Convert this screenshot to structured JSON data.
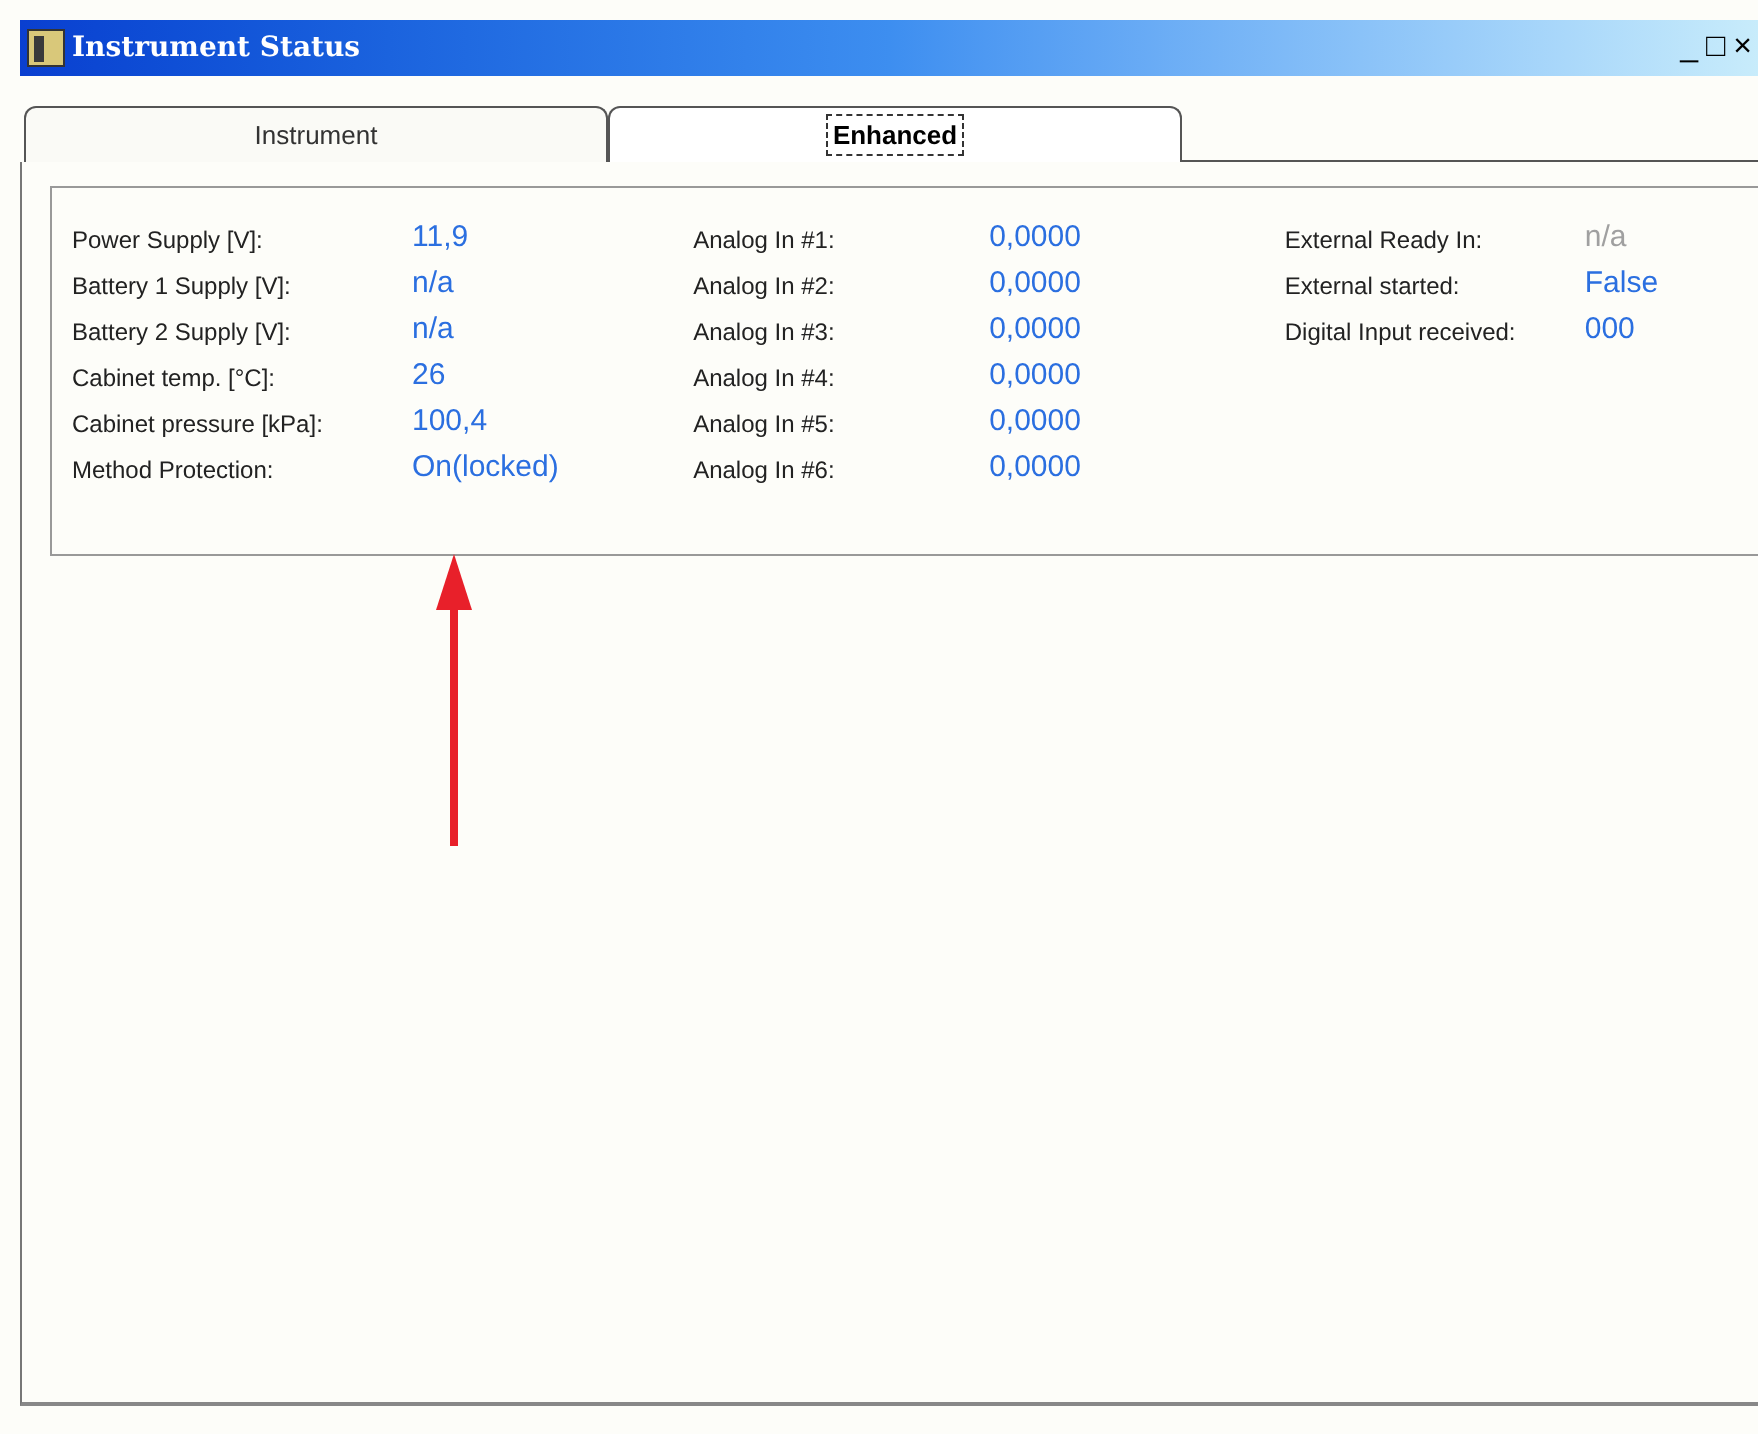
{
  "window": {
    "title": "Instrument Status",
    "controls": [
      "_",
      "□",
      "×"
    ]
  },
  "tabs": [
    {
      "label": "Instrument",
      "selected": false
    },
    {
      "label": "Enhanced",
      "selected": true
    }
  ],
  "columns": [
    {
      "rows": [
        {
          "label": "Power Supply [V]:",
          "value": "11,9",
          "dimmed": false
        },
        {
          "label": "Battery 1 Supply [V]:",
          "value": "n/a",
          "dimmed": false
        },
        {
          "label": "Battery 2 Supply [V]:",
          "value": "n/a",
          "dimmed": false
        },
        {
          "label": "Cabinet temp. [°C]:",
          "value": "26",
          "dimmed": false
        },
        {
          "label": "Cabinet pressure [kPa]:",
          "value": "100,4",
          "dimmed": false
        },
        {
          "label": "Method Protection:",
          "value": "On(locked)",
          "dimmed": false
        }
      ]
    },
    {
      "rows": [
        {
          "label": "Analog In #1:",
          "value": "0,0000",
          "dimmed": false
        },
        {
          "label": "Analog In #2:",
          "value": "0,0000",
          "dimmed": false
        },
        {
          "label": "Analog In #3:",
          "value": "0,0000",
          "dimmed": false
        },
        {
          "label": "Analog In #4:",
          "value": "0,0000",
          "dimmed": false
        },
        {
          "label": "Analog In #5:",
          "value": "0,0000",
          "dimmed": false
        },
        {
          "label": "Analog In #6:",
          "value": "0,0000",
          "dimmed": false
        }
      ]
    },
    {
      "rows": [
        {
          "label": "External Ready In:",
          "value": "n/a",
          "dimmed": true
        },
        {
          "label": "External started:",
          "value": "False",
          "dimmed": false
        },
        {
          "label": "Digital Input received:",
          "value": "000",
          "dimmed": false
        }
      ]
    }
  ]
}
